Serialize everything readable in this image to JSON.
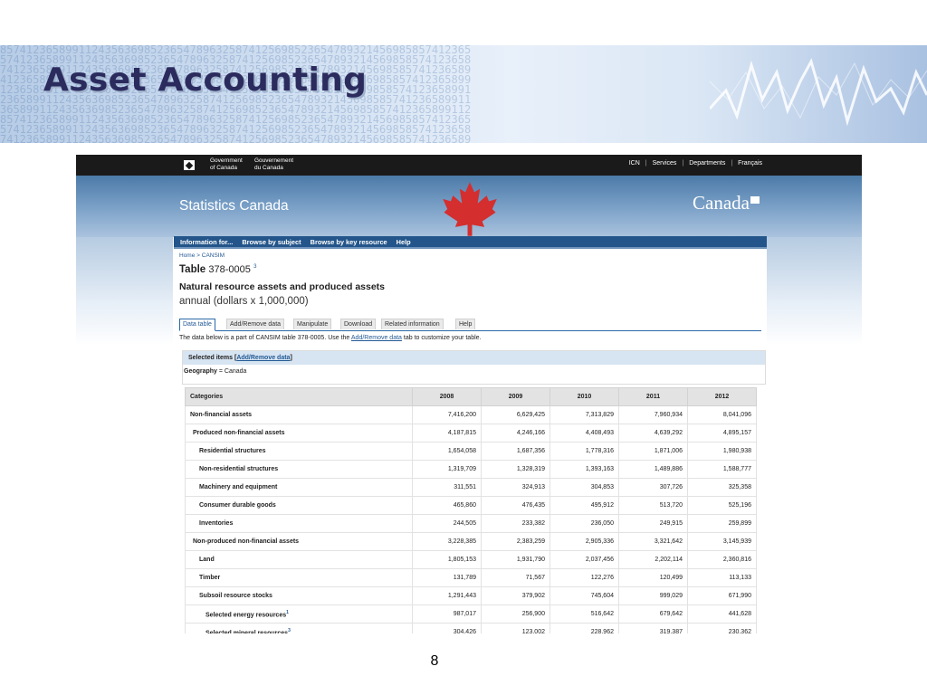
{
  "slide": {
    "title": "Asset Accounting",
    "page_number": "8"
  },
  "gov_bar": {
    "gov_en_1": "Government",
    "gov_en_2": "of Canada",
    "gov_fr_1": "Gouvernement",
    "gov_fr_2": "du Canada",
    "links": [
      "ICN",
      "Services",
      "Departments",
      "Français"
    ]
  },
  "header": {
    "site_name": "Statistics Canada",
    "wordmark": "Canada"
  },
  "nav": {
    "items": [
      "Information for...",
      "Browse by subject",
      "Browse by key resource",
      "Help"
    ]
  },
  "breadcrumb": "Home > CANSIM",
  "table_heading": {
    "label": "Table",
    "number": "378-0005",
    "footnote": "3",
    "subtitle": "Natural resource assets and produced assets",
    "frequency": "annual (dollars x 1,000,000)"
  },
  "tabs": [
    "Data table",
    "Add/Remove data",
    "Manipulate",
    "Download",
    "Related information",
    "Help"
  ],
  "intro": {
    "before": "The data below is a part of CANSIM table  378-0005.  Use the",
    "link": "Add/Remove data",
    "after": "tab to customize your table."
  },
  "selected": {
    "label": "Selected items [",
    "link": "Add/Remove data",
    "close": "]",
    "geo_label": "Geography",
    "geo_value": " = Canada"
  },
  "datatable": {
    "headers": [
      "Categories",
      "2008",
      "2009",
      "2010",
      "2011",
      "2012"
    ],
    "rows": [
      {
        "label": "Non-financial assets",
        "values": [
          "7,416,200",
          "6,629,425",
          "7,313,829",
          "7,960,934",
          "8,041,096"
        ]
      },
      {
        "label": "Produced non-financial assets",
        "values": [
          "4,187,815",
          "4,246,166",
          "4,408,493",
          "4,639,292",
          "4,895,157"
        ]
      },
      {
        "label": "Residential structures",
        "values": [
          "1,654,058",
          "1,687,356",
          "1,778,316",
          "1,871,006",
          "1,980,938"
        ]
      },
      {
        "label": "Non-residential structures",
        "values": [
          "1,319,709",
          "1,328,319",
          "1,393,163",
          "1,489,886",
          "1,588,777"
        ]
      },
      {
        "label": "Machinery and equipment",
        "values": [
          "311,551",
          "324,913",
          "304,853",
          "307,726",
          "325,358"
        ]
      },
      {
        "label": "Consumer durable goods",
        "values": [
          "465,860",
          "476,435",
          "495,912",
          "513,720",
          "525,196"
        ]
      },
      {
        "label": "Inventories",
        "values": [
          "244,505",
          "233,382",
          "236,050",
          "249,915",
          "259,899"
        ]
      },
      {
        "label": "Non-produced non-financial assets",
        "values": [
          "3,228,385",
          "2,383,259",
          "2,905,336",
          "3,321,642",
          "3,145,939"
        ]
      },
      {
        "label": "Land",
        "values": [
          "1,805,153",
          "1,931,790",
          "2,037,456",
          "2,202,114",
          "2,360,816"
        ]
      },
      {
        "label": "Timber",
        "values": [
          "131,789",
          "71,567",
          "122,276",
          "120,499",
          "113,133"
        ]
      },
      {
        "label": "Subsoil resource stocks",
        "values": [
          "1,291,443",
          "379,902",
          "745,604",
          "999,029",
          "671,990"
        ]
      },
      {
        "label": "Selected energy resources",
        "footnote": "1",
        "values": [
          "987,017",
          "256,900",
          "516,642",
          "679,642",
          "441,628"
        ]
      },
      {
        "label": "Selected mineral resources",
        "footnote": "3",
        "values": [
          "304,426",
          "123,002",
          "228,962",
          "319,387",
          "230,362"
        ]
      }
    ]
  },
  "colors": {
    "nav_bg": "#23558a",
    "gov_bar_bg": "#1a1a1a",
    "maple_red": "#d42e2e",
    "title_text": "#2b2b5e",
    "link": "#235a95"
  },
  "icons": [
    "canada-flag-icon",
    "maple-leaf-icon"
  ]
}
